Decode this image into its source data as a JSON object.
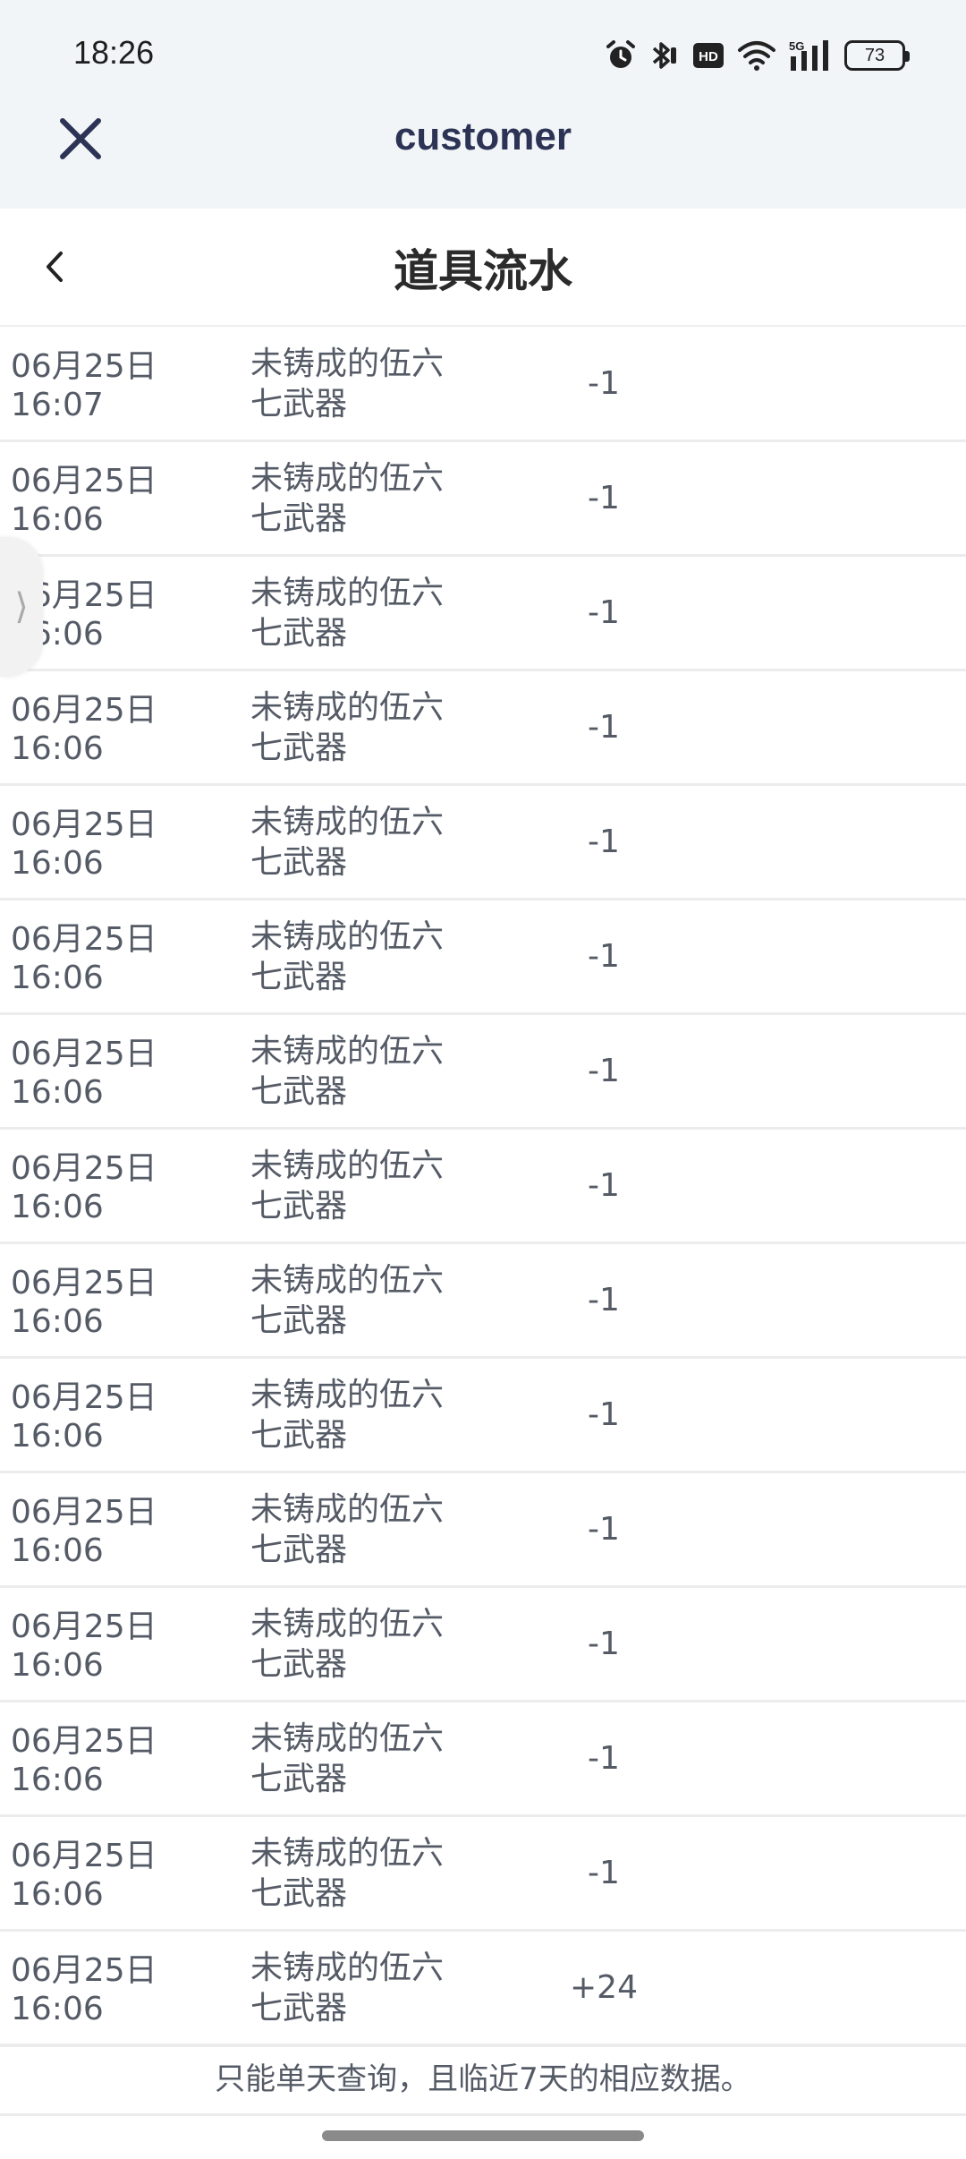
{
  "status_bar": {
    "time": "18:26",
    "battery": "73",
    "icons": [
      "alarm-icon",
      "bluetooth-icon",
      "hd-icon",
      "wifi-icon",
      "signal-5g-icon",
      "battery-icon"
    ]
  },
  "app_bar": {
    "title": "customer",
    "close_icon": "close-icon"
  },
  "page": {
    "title": "道具流水",
    "back_icon": "chevron-left-icon"
  },
  "rows": [
    {
      "date": "06月25日",
      "time": "16:07",
      "name_line1": "未铸成的伍六",
      "name_line2": "七武器",
      "amount": "-1"
    },
    {
      "date": "06月25日",
      "time": "16:06",
      "name_line1": "未铸成的伍六",
      "name_line2": "七武器",
      "amount": "-1"
    },
    {
      "date": "06月25日",
      "time": "16:06",
      "name_line1": "未铸成的伍六",
      "name_line2": "七武器",
      "amount": "-1"
    },
    {
      "date": "06月25日",
      "time": "16:06",
      "name_line1": "未铸成的伍六",
      "name_line2": "七武器",
      "amount": "-1"
    },
    {
      "date": "06月25日",
      "time": "16:06",
      "name_line1": "未铸成的伍六",
      "name_line2": "七武器",
      "amount": "-1"
    },
    {
      "date": "06月25日",
      "time": "16:06",
      "name_line1": "未铸成的伍六",
      "name_line2": "七武器",
      "amount": "-1"
    },
    {
      "date": "06月25日",
      "time": "16:06",
      "name_line1": "未铸成的伍六",
      "name_line2": "七武器",
      "amount": "-1"
    },
    {
      "date": "06月25日",
      "time": "16:06",
      "name_line1": "未铸成的伍六",
      "name_line2": "七武器",
      "amount": "-1"
    },
    {
      "date": "06月25日",
      "time": "16:06",
      "name_line1": "未铸成的伍六",
      "name_line2": "七武器",
      "amount": "-1"
    },
    {
      "date": "06月25日",
      "time": "16:06",
      "name_line1": "未铸成的伍六",
      "name_line2": "七武器",
      "amount": "-1"
    },
    {
      "date": "06月25日",
      "time": "16:06",
      "name_line1": "未铸成的伍六",
      "name_line2": "七武器",
      "amount": "-1"
    },
    {
      "date": "06月25日",
      "time": "16:06",
      "name_line1": "未铸成的伍六",
      "name_line2": "七武器",
      "amount": "-1"
    },
    {
      "date": "06月25日",
      "time": "16:06",
      "name_line1": "未铸成的伍六",
      "name_line2": "七武器",
      "amount": "-1"
    },
    {
      "date": "06月25日",
      "time": "16:06",
      "name_line1": "未铸成的伍六",
      "name_line2": "七武器",
      "amount": "-1"
    },
    {
      "date": "06月25日",
      "time": "16:06",
      "name_line1": "未铸成的伍六",
      "name_line2": "七武器",
      "amount": "+24"
    }
  ],
  "footer": {
    "notice": "只能单天查询，且临近7天的相应数据。"
  },
  "side_tab": {
    "icon": "chevron-right-icon",
    "glyph": "⟩"
  }
}
